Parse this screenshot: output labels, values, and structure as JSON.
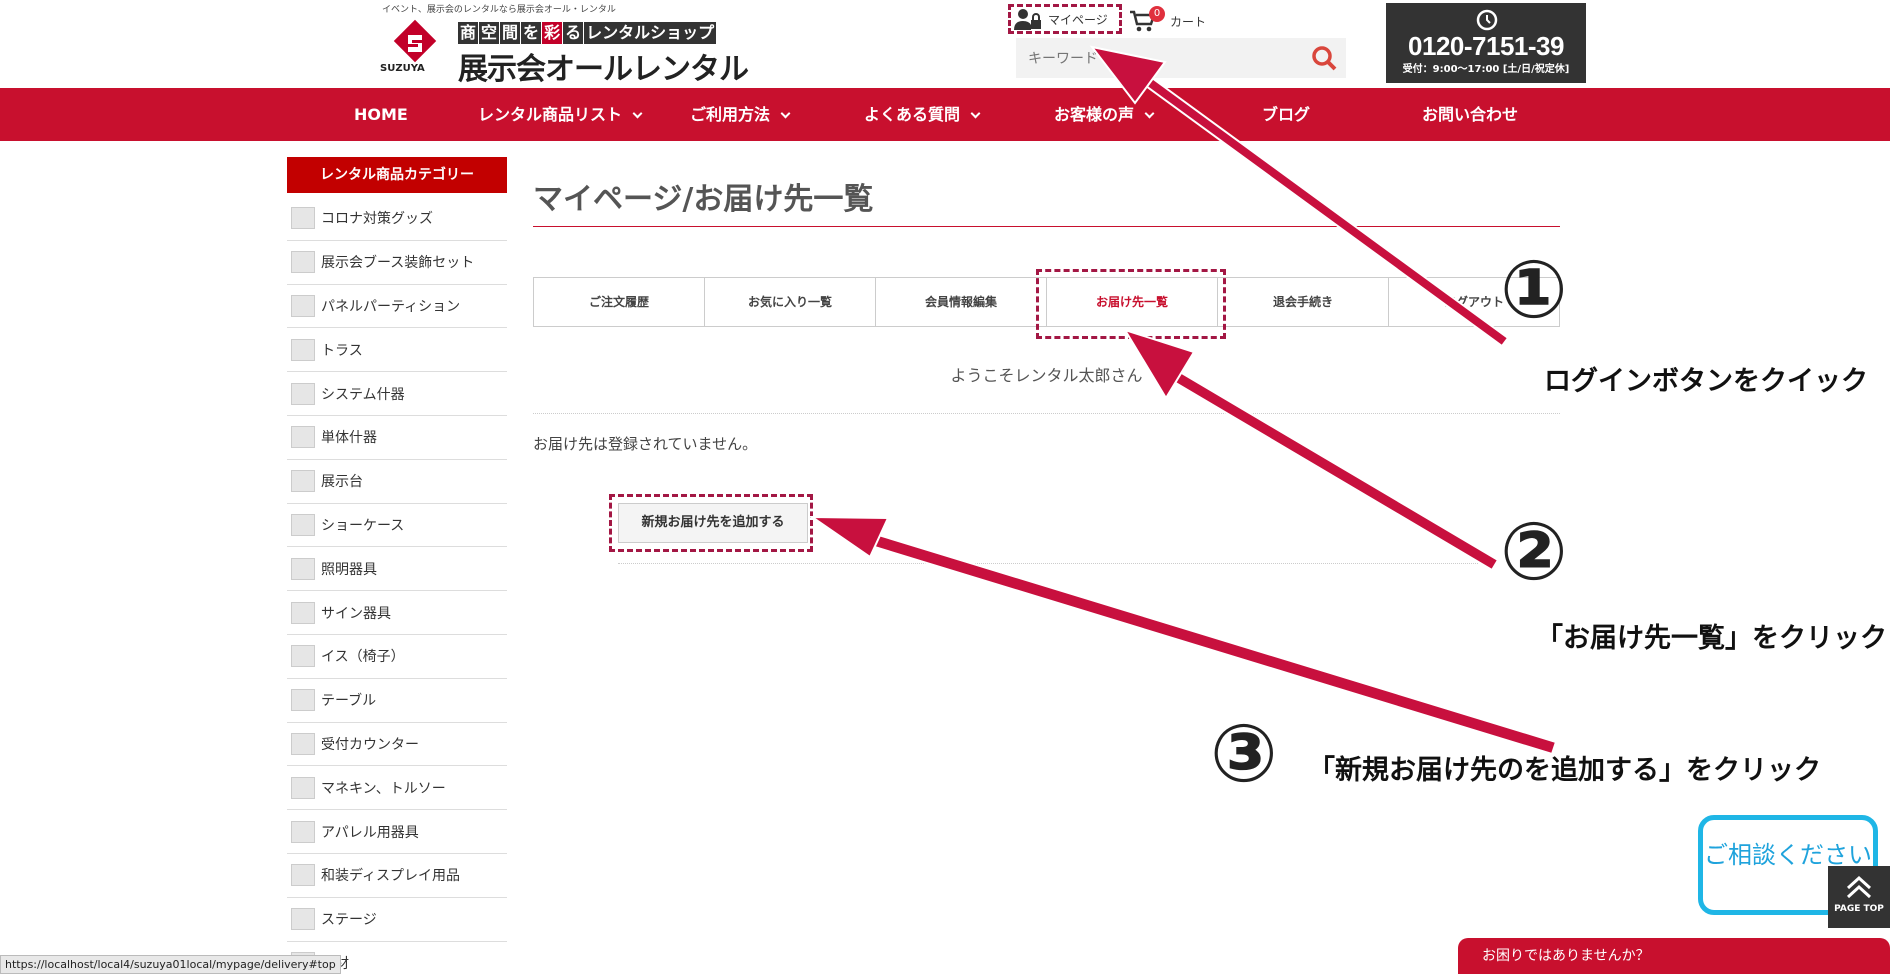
{
  "header": {
    "tagline": "イベント、展示会のレンタルなら展示会オール・レンタル",
    "logo_brand": "SUZUYA",
    "logo_catch": [
      "商",
      "空",
      "間",
      "を",
      "彩",
      "る",
      "レンタルショップ"
    ],
    "logo_name": "展示会オールレンタル",
    "mypage_label": "マイページ",
    "cart_label": "カート",
    "cart_count": "0",
    "search_placeholder": "キーワード",
    "phone_number": "0120-7151-39",
    "phone_hours": "受付：9:00〜17:00 [土/日/祝定休]"
  },
  "nav": [
    "HOME",
    "レンタル商品リスト",
    "ご利用方法",
    "よくある質問",
    "お客様の声",
    "ブログ",
    "お問い合わせ"
  ],
  "sidebar": {
    "title": "レンタル商品カテゴリー",
    "items": [
      "コロナ対策グッズ",
      "展示会ブース装飾セット",
      "パネルパーティション",
      "トラス",
      "システム什器",
      "単体什器",
      "展示台",
      "ショーケース",
      "照明器具",
      "サイン器具",
      "イス（椅子）",
      "テーブル",
      "受付カウンター",
      "マネキン、トルソー",
      "アパレル用器具",
      "和装ディスプレイ用品",
      "ステージ",
      "床材"
    ]
  },
  "main": {
    "title": "マイページ/お届け先一覧",
    "tabs": [
      "ご注文履歴",
      "お気に入り一覧",
      "会員情報編集",
      "お届け先一覧",
      "退会手続き",
      "ログアウト"
    ],
    "active_tab": "お届け先一覧",
    "welcome": "ようこそレンタル太郎さん",
    "no_address": "お届け先は登録されていません。",
    "add_button": "新規お届け先を追加する"
  },
  "annotations": {
    "step1_num": "①",
    "step1_text": "ログインボタンをクイック",
    "step2_num": "②",
    "step2_text": "「お届け先一覧」をクリック",
    "step3_num": "③",
    "step3_text": "「新規お届け先のを追加する」をクリック",
    "arrow_color": "#c8103e"
  },
  "floating": {
    "consult_text": "ご相談ください",
    "pagetop_label": "PAGE TOP",
    "help_text": "お困りではありませんか？",
    "status_url": "https://localhost/local4/suzuya01local/mypage/delivery#top"
  },
  "colors": {
    "brand_red": "#c8102e",
    "consult_blue": "#1fb6e6"
  }
}
